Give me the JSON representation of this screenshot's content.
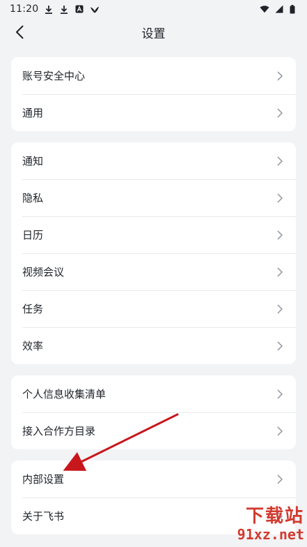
{
  "status_bar": {
    "time": "11:20",
    "left_icons": [
      "download-icon",
      "download-icon",
      "app-a-icon",
      "bird-icon"
    ],
    "right_icons": [
      "wifi-icon",
      "signal-icon",
      "battery-icon"
    ]
  },
  "header": {
    "title": "设置"
  },
  "groups": [
    {
      "rows": [
        {
          "label": "账号安全中心"
        },
        {
          "label": "通用"
        }
      ]
    },
    {
      "rows": [
        {
          "label": "通知"
        },
        {
          "label": "隐私"
        },
        {
          "label": "日历"
        },
        {
          "label": "视频会议"
        },
        {
          "label": "任务"
        },
        {
          "label": "效率"
        }
      ]
    },
    {
      "rows": [
        {
          "label": "个人信息收集清单"
        },
        {
          "label": "接入合作方目录"
        }
      ]
    },
    {
      "rows": [
        {
          "label": "内部设置"
        },
        {
          "label": "关于飞书"
        }
      ]
    }
  ],
  "watermark": {
    "cn": "下载站",
    "site": "91xz.net"
  },
  "colors": {
    "background": "#f2f3f5",
    "card": "#ffffff",
    "text": "#1f2329",
    "arrow": "#c8161d"
  }
}
